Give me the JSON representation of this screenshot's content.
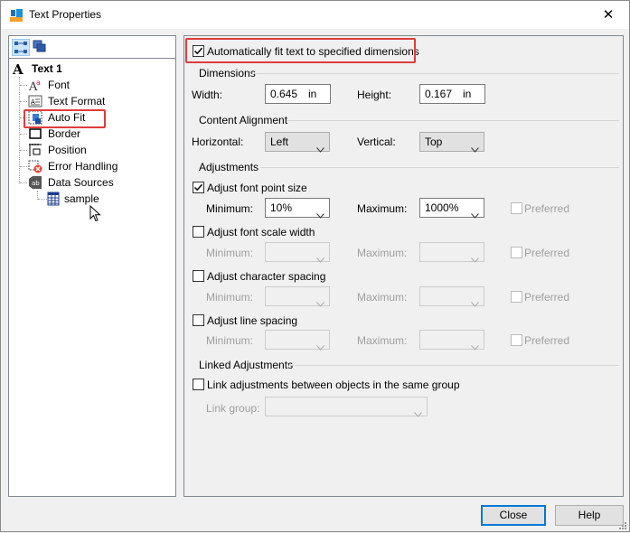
{
  "window": {
    "title": "Text Properties",
    "close_glyph": "✕"
  },
  "tree": {
    "toolbar_icons": [
      "tree-view-icon",
      "layers-icon"
    ],
    "root": {
      "label": "Text 1",
      "icon": "text-a-icon"
    },
    "items": [
      {
        "label": "Font",
        "icon": "font-icon"
      },
      {
        "label": "Text Format",
        "icon": "text-format-icon"
      },
      {
        "label": "Auto Fit",
        "icon": "auto-fit-icon",
        "highlighted": true
      },
      {
        "label": "Border",
        "icon": "border-icon"
      },
      {
        "label": "Position",
        "icon": "position-icon"
      },
      {
        "label": "Error Handling",
        "icon": "error-handling-icon"
      },
      {
        "label": "Data Sources",
        "icon": "data-sources-icon"
      }
    ],
    "child": {
      "label": "sample",
      "icon": "database-icon"
    }
  },
  "auto_fit": {
    "label": "Automatically fit text to specified dimensions",
    "checked": true
  },
  "dimensions": {
    "group_label": "Dimensions",
    "width_label": "Width:",
    "width_value": "0.645",
    "width_unit": "in",
    "height_label": "Height:",
    "height_value": "0.167",
    "height_unit": "in"
  },
  "alignment": {
    "group_label": "Content Alignment",
    "horizontal_label": "Horizontal:",
    "horizontal_value": "Left",
    "vertical_label": "Vertical:",
    "vertical_value": "Top"
  },
  "adjustments": {
    "group_label": "Adjustments",
    "minimum_label": "Minimum:",
    "maximum_label": "Maximum:",
    "preferred_label": "Preferred",
    "font_point": {
      "label": "Adjust font point size",
      "checked": true,
      "min": "10%",
      "max": "1000%"
    },
    "font_scale": {
      "label": "Adjust font scale width",
      "checked": false
    },
    "char_spacing": {
      "label": "Adjust character spacing",
      "checked": false
    },
    "line_spacing": {
      "label": "Adjust line spacing",
      "checked": false
    }
  },
  "linked": {
    "group_label": "Linked Adjustments",
    "link_label": "Link adjustments between objects in the same group",
    "checked": false,
    "link_group_label": "Link group:"
  },
  "buttons": {
    "close": "Close",
    "help": "Help"
  },
  "colors": {
    "highlight_red": "#e03c3c",
    "focus_blue": "#0078d7"
  }
}
